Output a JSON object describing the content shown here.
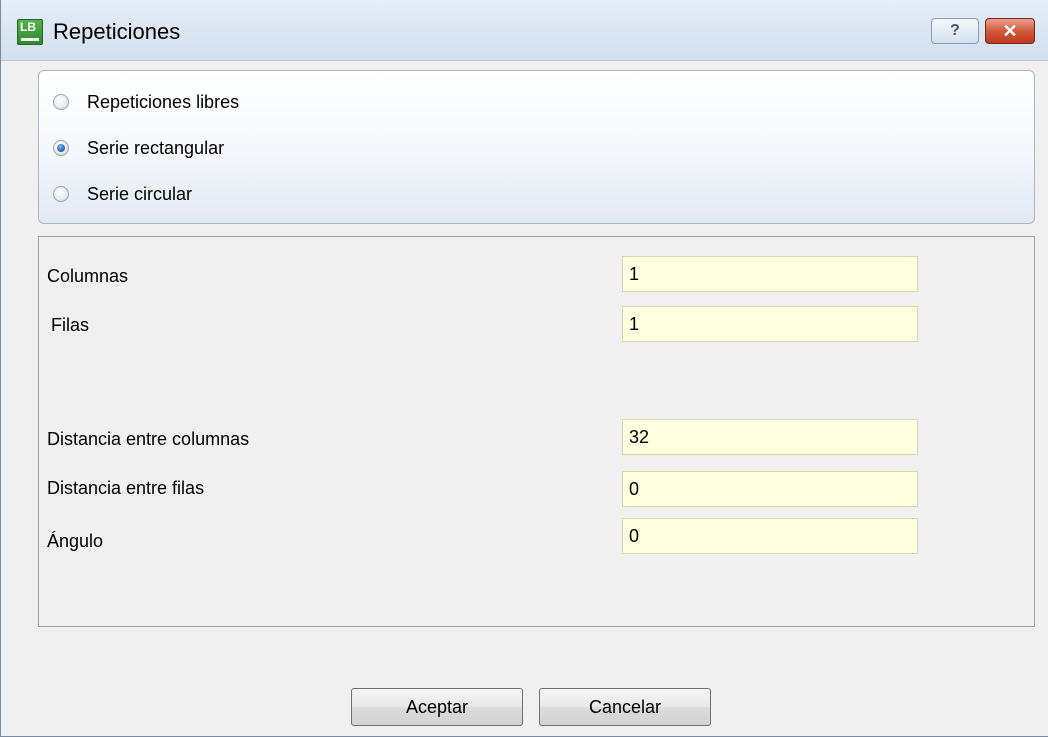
{
  "window": {
    "title": "Repeticiones",
    "app_icon": "app-logo-icon",
    "help_glyph": "?",
    "close_glyph": "✕"
  },
  "mode": {
    "options": [
      {
        "label": "Repeticiones libres",
        "checked": false
      },
      {
        "label": "Serie rectangular",
        "checked": true
      },
      {
        "label": "Serie circular",
        "checked": false
      }
    ]
  },
  "fields": {
    "columnas": {
      "label": "Columnas",
      "value": "1"
    },
    "filas": {
      "label": "Filas",
      "value": "1"
    },
    "distancia_columnas": {
      "label": "Distancia entre columnas",
      "value": "32"
    },
    "distancia_filas": {
      "label": "Distancia entre filas",
      "value": "0"
    },
    "angulo": {
      "label": "Ángulo",
      "value": "0"
    }
  },
  "buttons": {
    "accept": "Aceptar",
    "cancel": "Cancelar"
  },
  "colors": {
    "input_bg": "#ffffe0",
    "close_button": "#c1371c"
  }
}
